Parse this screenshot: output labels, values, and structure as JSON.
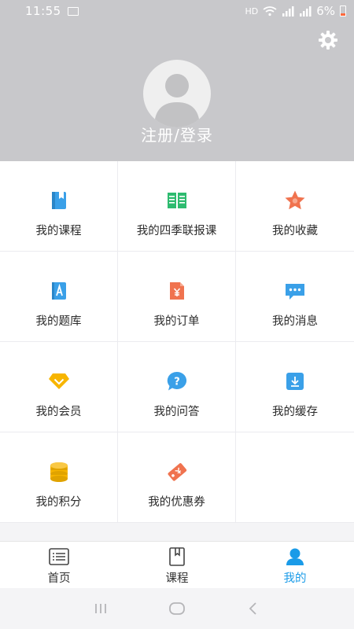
{
  "status": {
    "time": "11:55",
    "hd": "HD",
    "battery": "6%"
  },
  "profile": {
    "login_label": "注册/登录"
  },
  "grid": [
    {
      "label": "我的课程",
      "icon": "book-icon",
      "color": "#3aa0e8"
    },
    {
      "label": "我的四季联报课",
      "icon": "open-book-icon",
      "color": "#2dbb6f"
    },
    {
      "label": "我的收藏",
      "icon": "star-icon",
      "color": "#f0734f"
    },
    {
      "label": "我的题库",
      "icon": "question-bank-icon",
      "color": "#3aa0e8"
    },
    {
      "label": "我的订单",
      "icon": "order-icon",
      "color": "#f0734f"
    },
    {
      "label": "我的消息",
      "icon": "message-icon",
      "color": "#3aa0e8"
    },
    {
      "label": "我的会员",
      "icon": "member-diamond-icon",
      "color": "#f7b500"
    },
    {
      "label": "我的问答",
      "icon": "qa-icon",
      "color": "#3aa0e8"
    },
    {
      "label": "我的缓存",
      "icon": "download-cache-icon",
      "color": "#3aa0e8"
    },
    {
      "label": "我的积分",
      "icon": "coins-icon",
      "color": "#f7b500"
    },
    {
      "label": "我的优惠券",
      "icon": "coupon-icon",
      "color": "#f0734f"
    }
  ],
  "tabs": [
    {
      "label": "首页",
      "icon": "home-list-icon",
      "active": false
    },
    {
      "label": "课程",
      "icon": "course-book-icon",
      "active": false
    },
    {
      "label": "我的",
      "icon": "profile-icon",
      "active": true
    }
  ],
  "colors": {
    "accent": "#1a9be8",
    "header_bg": "#c8c8cb"
  }
}
